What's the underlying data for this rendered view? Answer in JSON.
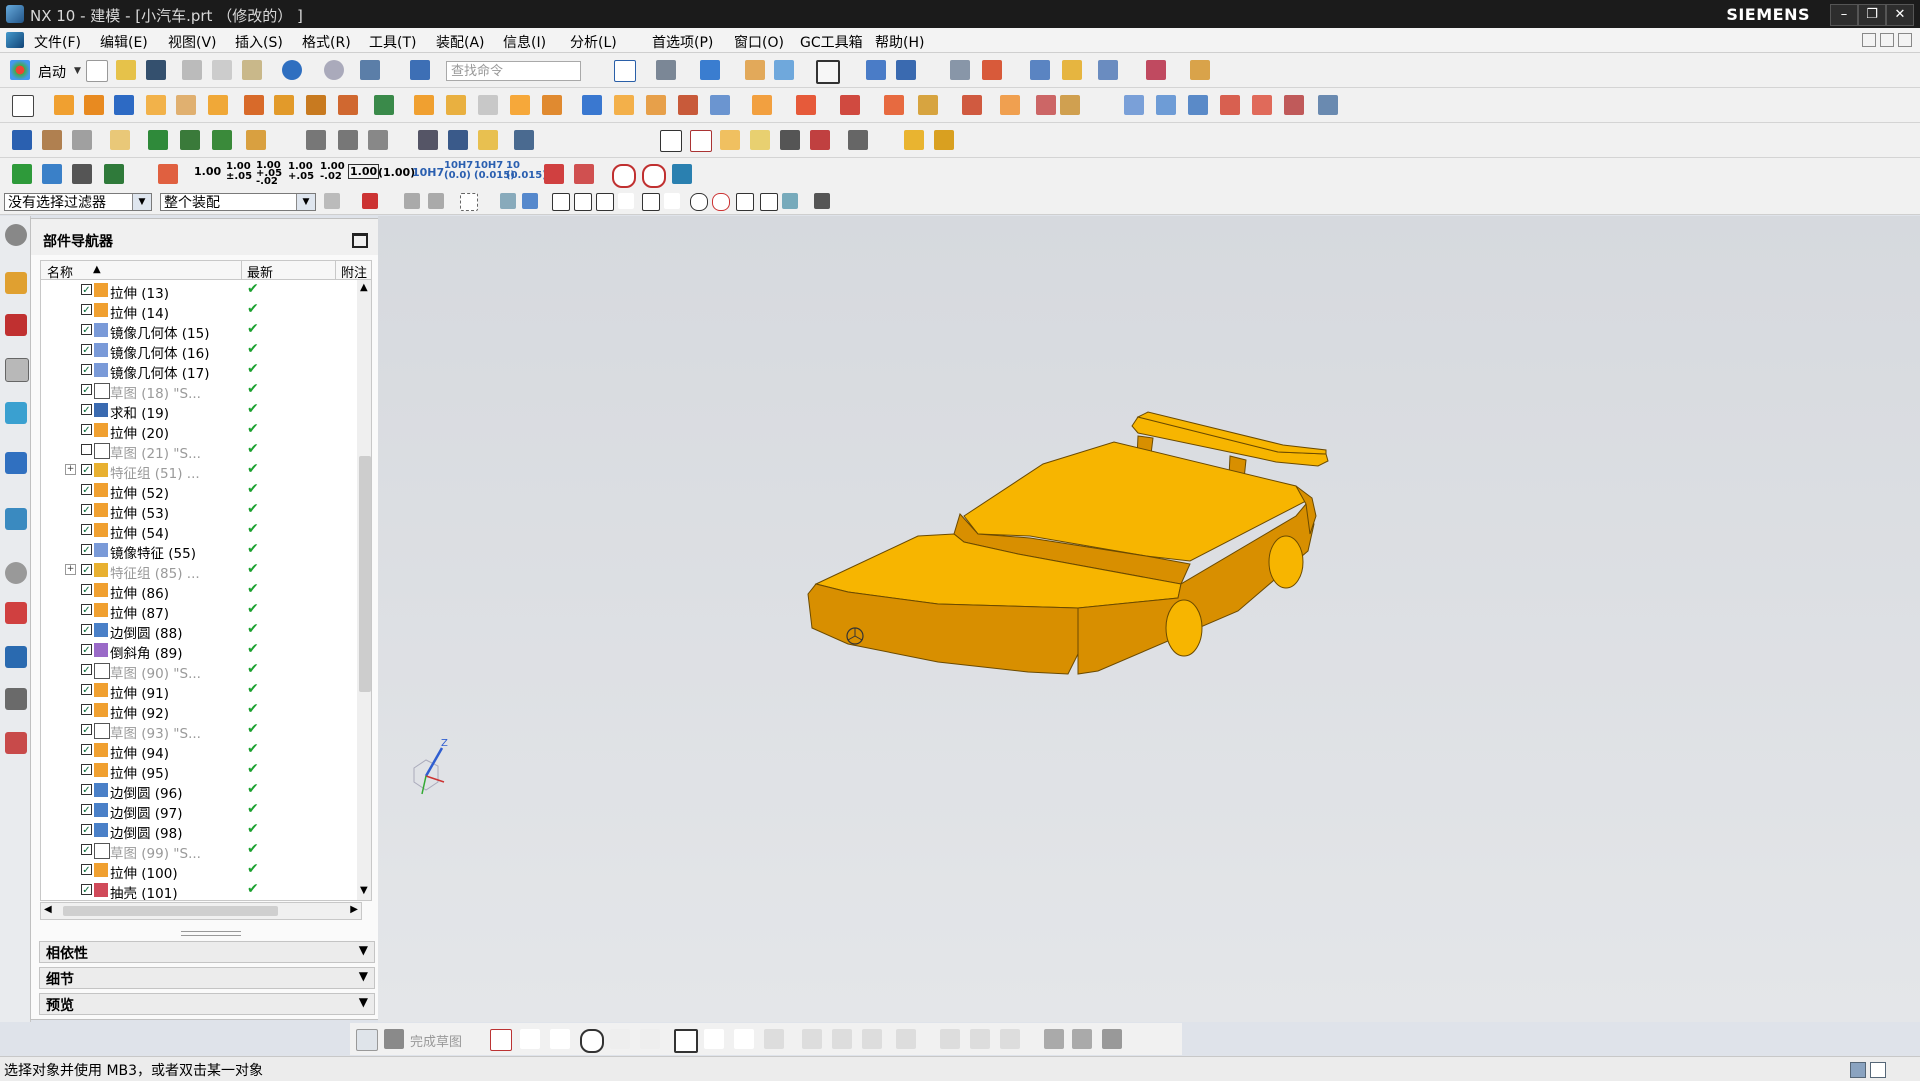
{
  "window": {
    "title": "NX 10 - 建模 - [小汽车.prt  （修改的）  ]",
    "brand": "SIEMENS",
    "buttons": [
      "–",
      "❐",
      "✕"
    ]
  },
  "menubar": {
    "items": [
      "文件(F)",
      "编辑(E)",
      "视图(V)",
      "插入(S)",
      "格式(R)",
      "工具(T)",
      "装配(A)",
      "信息(I)",
      "分析(L)",
      "首选项(P)",
      "窗口(O)",
      "GC工具箱",
      "帮助(H)"
    ]
  },
  "toolbar": {
    "start_label": "启动",
    "search_placeholder": "查找命令",
    "dimension_labels": [
      "1.00",
      "1.00\n±.05",
      "1.00\n+.05\n-.02",
      "1.00\n+.05",
      "1.00\n-.02",
      "1.00",
      "(1.00)",
      "10H7",
      "10H7\n(0.0)",
      "10H7\n(0.015)",
      "10\n(0.015)"
    ]
  },
  "filterbar": {
    "selection_filter": "没有选择过滤器",
    "scope": "整个装配"
  },
  "navigator": {
    "title": "部件导航器",
    "columns": {
      "name": "名称",
      "latest": "最新",
      "note": "附注"
    },
    "rows": [
      {
        "label": "拉伸 (13)",
        "icon": "extrude-icon",
        "grey": false,
        "checked": true
      },
      {
        "label": "拉伸 (14)",
        "icon": "extrude-icon",
        "grey": false,
        "checked": true
      },
      {
        "label": "镜像几何体 (15)",
        "icon": "mirror-icon",
        "grey": false,
        "checked": true
      },
      {
        "label": "镜像几何体 (16)",
        "icon": "mirror-icon",
        "grey": false,
        "checked": true
      },
      {
        "label": "镜像几何体 (17)",
        "icon": "mirror-icon",
        "grey": false,
        "checked": true
      },
      {
        "label": "草图 (18) \"S...",
        "icon": "sketch-icon",
        "grey": true,
        "checked": true
      },
      {
        "label": "求和 (19)",
        "icon": "unite-icon",
        "grey": false,
        "checked": true
      },
      {
        "label": "拉伸 (20)",
        "icon": "extrude-icon",
        "grey": false,
        "checked": true
      },
      {
        "label": "草图 (21) \"S...",
        "icon": "sketch-icon",
        "grey": true,
        "checked": false
      },
      {
        "label": "特征组 (51) ...",
        "icon": "feature-group-icon",
        "grey": true,
        "checked": true,
        "expandable": true
      },
      {
        "label": "拉伸 (52)",
        "icon": "extrude-icon",
        "grey": false,
        "checked": true
      },
      {
        "label": "拉伸 (53)",
        "icon": "extrude-icon",
        "grey": false,
        "checked": true
      },
      {
        "label": "拉伸 (54)",
        "icon": "extrude-icon",
        "grey": false,
        "checked": true
      },
      {
        "label": "镜像特征 (55)",
        "icon": "mirror-icon",
        "grey": false,
        "checked": true
      },
      {
        "label": "特征组 (85) ...",
        "icon": "feature-group-icon",
        "grey": true,
        "checked": true,
        "expandable": true
      },
      {
        "label": "拉伸 (86)",
        "icon": "extrude-icon",
        "grey": false,
        "checked": true
      },
      {
        "label": "拉伸 (87)",
        "icon": "extrude-icon",
        "grey": false,
        "checked": true
      },
      {
        "label": "边倒圆 (88)",
        "icon": "blend-icon",
        "grey": false,
        "checked": true
      },
      {
        "label": "倒斜角 (89)",
        "icon": "chamfer-icon",
        "grey": false,
        "checked": true
      },
      {
        "label": "草图 (90) \"S...",
        "icon": "sketch-icon",
        "grey": true,
        "checked": true
      },
      {
        "label": "拉伸 (91)",
        "icon": "extrude-icon",
        "grey": false,
        "checked": true
      },
      {
        "label": "拉伸 (92)",
        "icon": "extrude-icon",
        "grey": false,
        "checked": true
      },
      {
        "label": "草图 (93) \"S...",
        "icon": "sketch-icon",
        "grey": true,
        "checked": true
      },
      {
        "label": "拉伸 (94)",
        "icon": "extrude-icon",
        "grey": false,
        "checked": true
      },
      {
        "label": "拉伸 (95)",
        "icon": "extrude-icon",
        "grey": false,
        "checked": true
      },
      {
        "label": "边倒圆 (96)",
        "icon": "blend-icon",
        "grey": false,
        "checked": true
      },
      {
        "label": "边倒圆 (97)",
        "icon": "blend-icon",
        "grey": false,
        "checked": true
      },
      {
        "label": "边倒圆 (98)",
        "icon": "blend-icon",
        "grey": false,
        "checked": true
      },
      {
        "label": "草图 (99) \"S...",
        "icon": "sketch-icon",
        "grey": true,
        "checked": true
      },
      {
        "label": "拉伸 (100)",
        "icon": "extrude-icon",
        "grey": false,
        "checked": true
      },
      {
        "label": "抽壳 (101)",
        "icon": "shell-icon",
        "grey": false,
        "checked": true
      }
    ],
    "latest_mark": "✔",
    "panels": [
      "相依性",
      "细节",
      "预览"
    ]
  },
  "bottom_toolbar": {
    "finish_sketch": "完成草图"
  },
  "status": {
    "text": "选择对象并使用 MB3，或者双击某一对象"
  },
  "colors": {
    "model": "#f7b500",
    "model_shadow": "#d88f00",
    "check_green": "#1ba12f",
    "viewport_bg": "#dcdfe3"
  }
}
